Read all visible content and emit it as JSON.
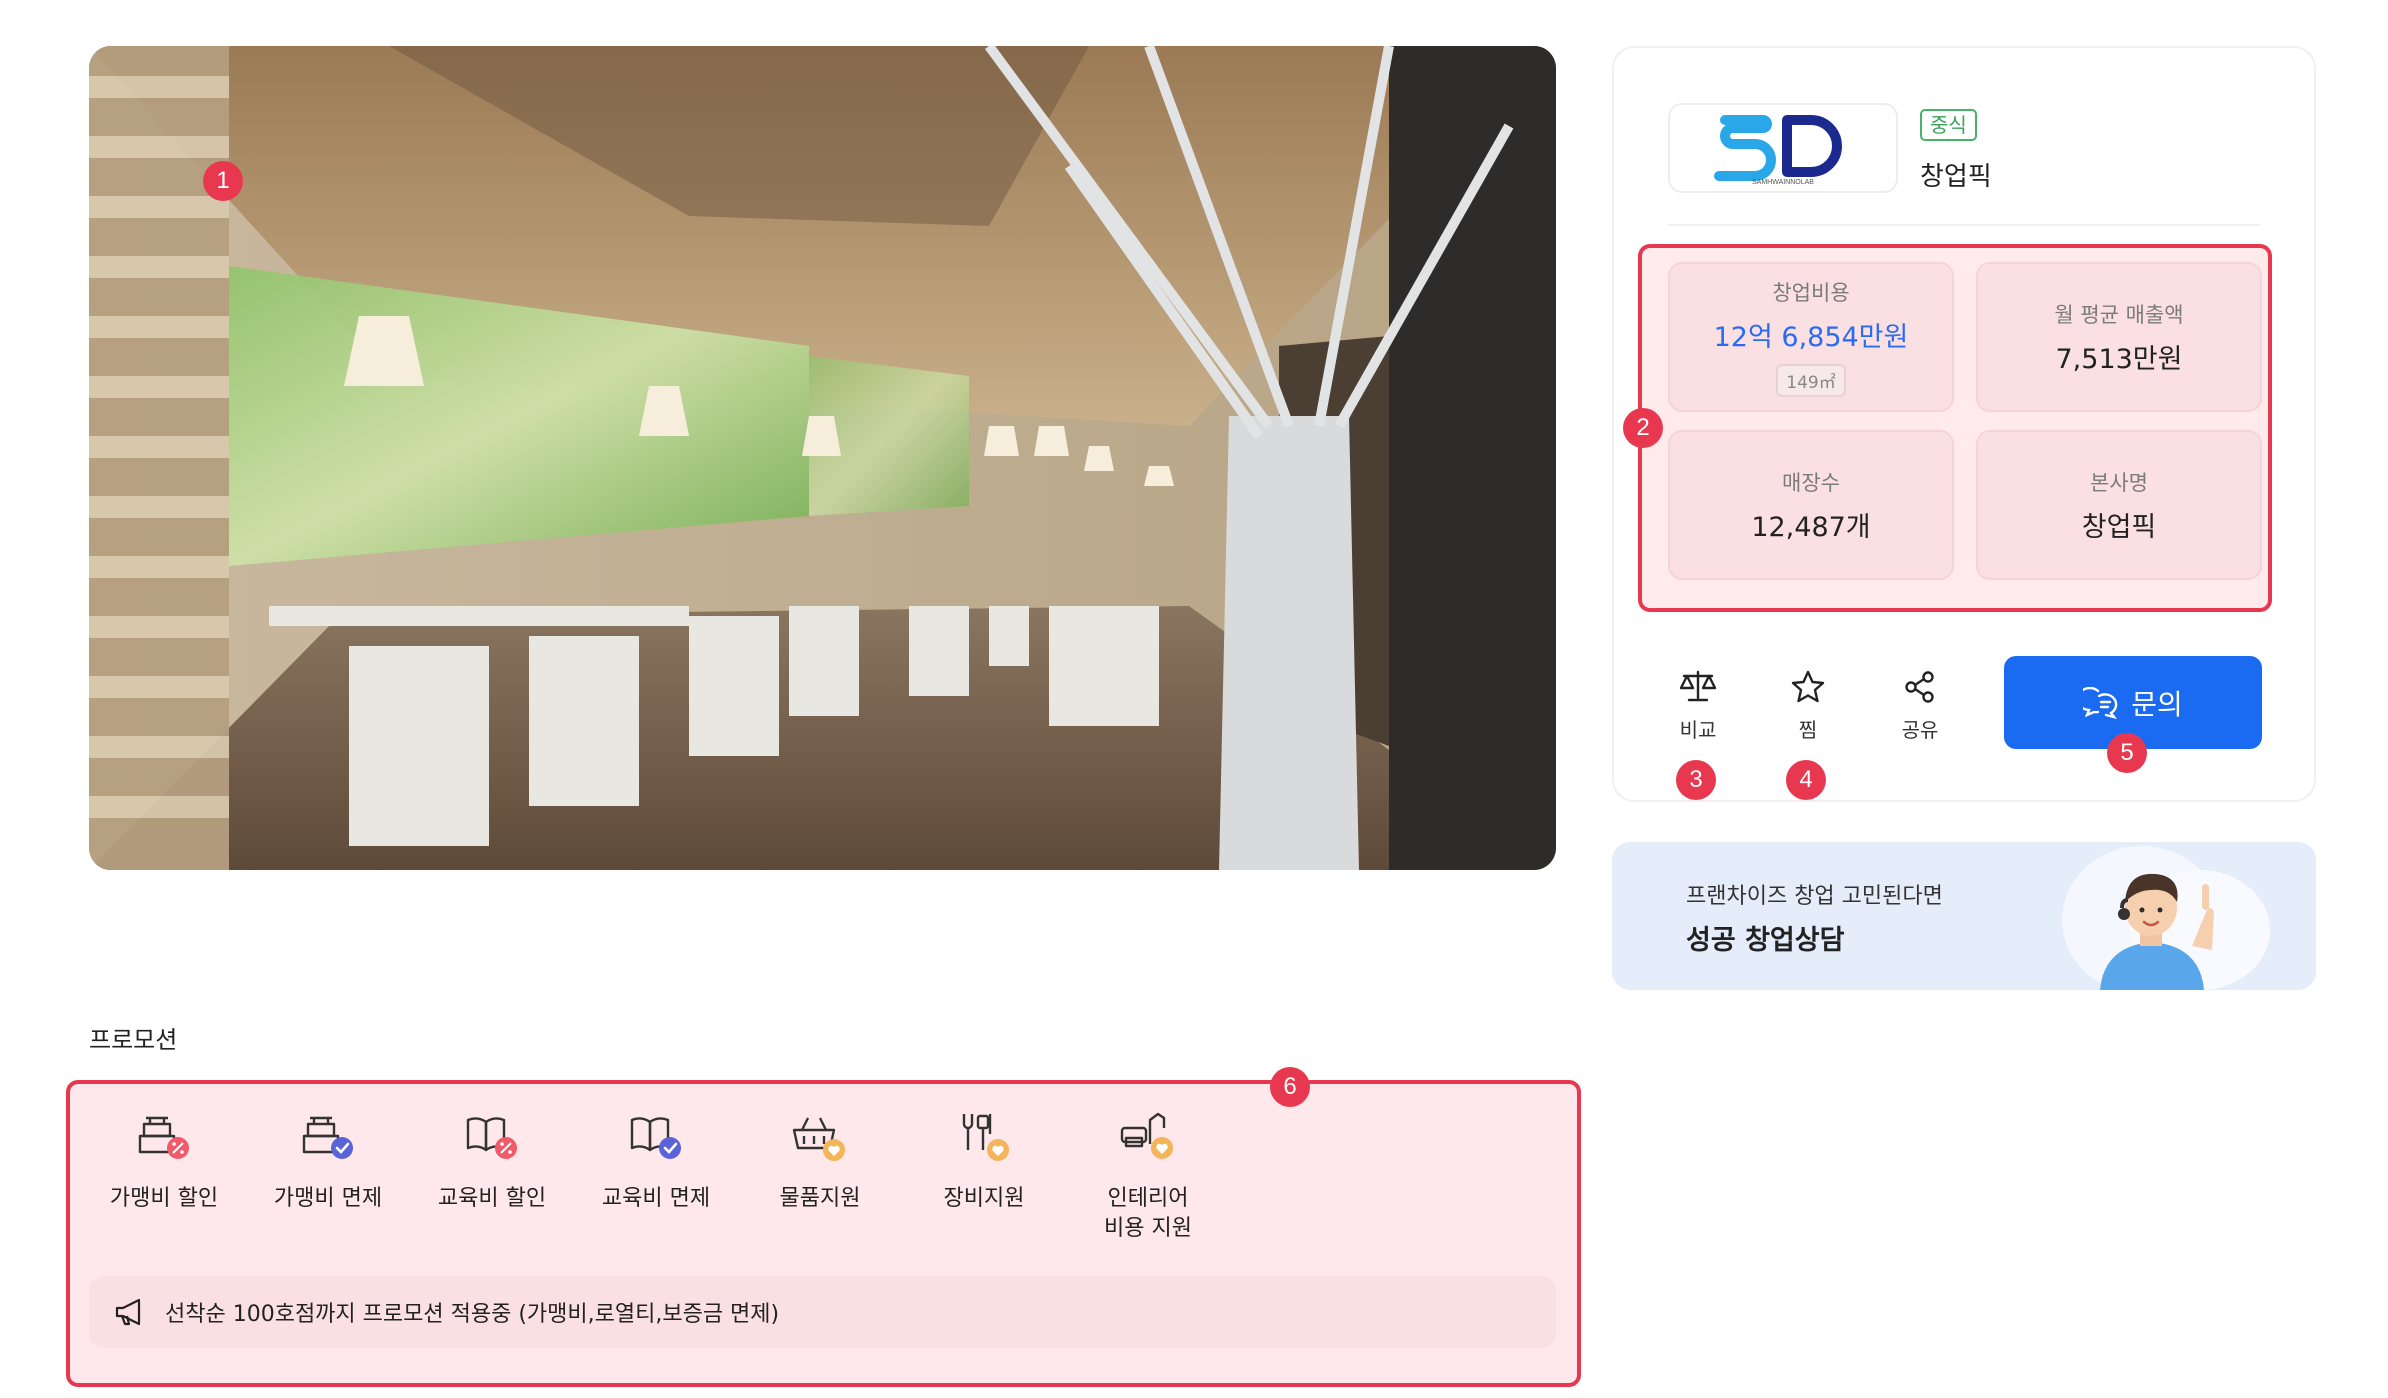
{
  "hero": {
    "image_alt": "restaurant interior"
  },
  "badges": [
    "1",
    "2",
    "3",
    "4",
    "5",
    "6"
  ],
  "brand": {
    "logo_text": "SD",
    "logo_caption": "SAMHWAINNOLAB",
    "category_tag": "중식",
    "name": "창업픽"
  },
  "stats": {
    "startup_cost": {
      "label": "창업비용",
      "value": "12억 6,854만원",
      "area": "149㎡"
    },
    "monthly_sales": {
      "label": "월 평균 매출액",
      "value": "7,513만원"
    },
    "store_count": {
      "label": "매장수",
      "value": "12,487개"
    },
    "hq_name": {
      "label": "본사명",
      "value": "창업픽"
    }
  },
  "actions": {
    "compare": "비교",
    "favorite": "찜",
    "share": "공유",
    "inquiry": "문의"
  },
  "consult": {
    "subtitle": "프랜차이즈 창업 고민된다면",
    "title": "성공 창업상담"
  },
  "promotion": {
    "title": "프로모션",
    "items": [
      {
        "label": "가맹비 할인",
        "icon": "franchise-fee-discount-icon"
      },
      {
        "label": "가맹비 면제",
        "icon": "franchise-fee-exempt-icon"
      },
      {
        "label": "교육비 할인",
        "icon": "education-fee-discount-icon"
      },
      {
        "label": "교육비 면제",
        "icon": "education-fee-exempt-icon"
      },
      {
        "label": "물품지원",
        "icon": "goods-support-icon"
      },
      {
        "label": "장비지원",
        "icon": "equipment-support-icon"
      },
      {
        "label": "인테리어\n비용 지원",
        "icon": "interior-support-icon"
      }
    ],
    "notice": "선착순 100호점까지 프로모션 적용중 (가맹비,로열티,보증금 면제)"
  },
  "colors": {
    "accent_blue": "#1a6bf2",
    "annotation_red": "#e8384f",
    "category_green": "#3aa25b"
  }
}
